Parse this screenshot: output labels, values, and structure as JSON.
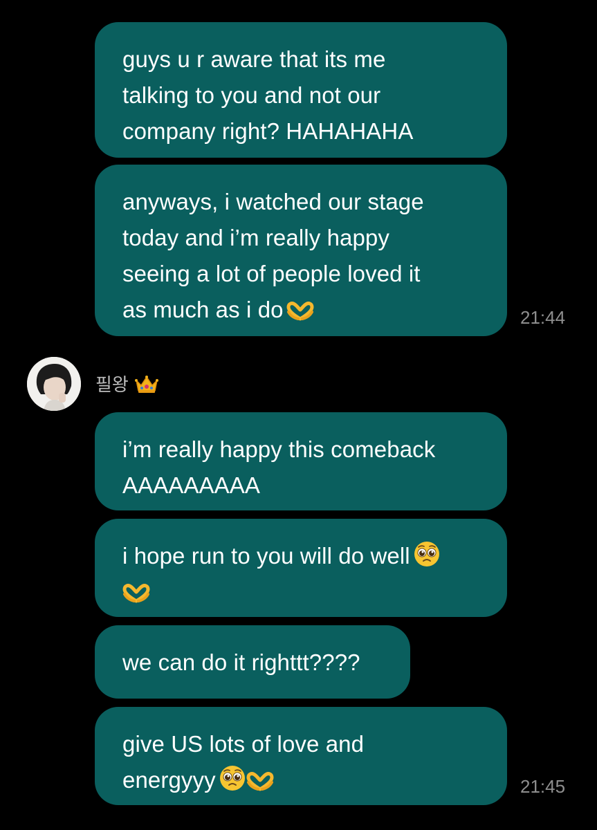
{
  "messages_group_1": [
    {
      "lines": [
        "guys u r aware that its me",
        "talking to you and not our",
        "company right? HAHAHAHA"
      ]
    },
    {
      "lines": [
        "anyways, i watched our stage",
        "today and i’m really happy",
        "seeing a lot of people loved it",
        "as much as i do"
      ]
    }
  ],
  "time_1": "21:44",
  "sender": {
    "name": "필왕",
    "badge_icon": "crown-icon"
  },
  "messages_group_2": [
    {
      "lines": [
        "i’m really happy this comeback",
        "AAAAAAAAA"
      ]
    },
    {
      "lines": [
        "i hope run to you will do well",
        ""
      ]
    },
    {
      "lines": [
        "we can do it righttt????"
      ]
    },
    {
      "lines": [
        "give US lots of love and",
        "energyyy"
      ]
    }
  ],
  "time_2": "21:45",
  "colors": {
    "background": "#000000",
    "bubble": "#0a5f5e",
    "text": "#ffffff",
    "timestamp": "#8e8e8e",
    "sender_name": "#bdbdbd"
  }
}
